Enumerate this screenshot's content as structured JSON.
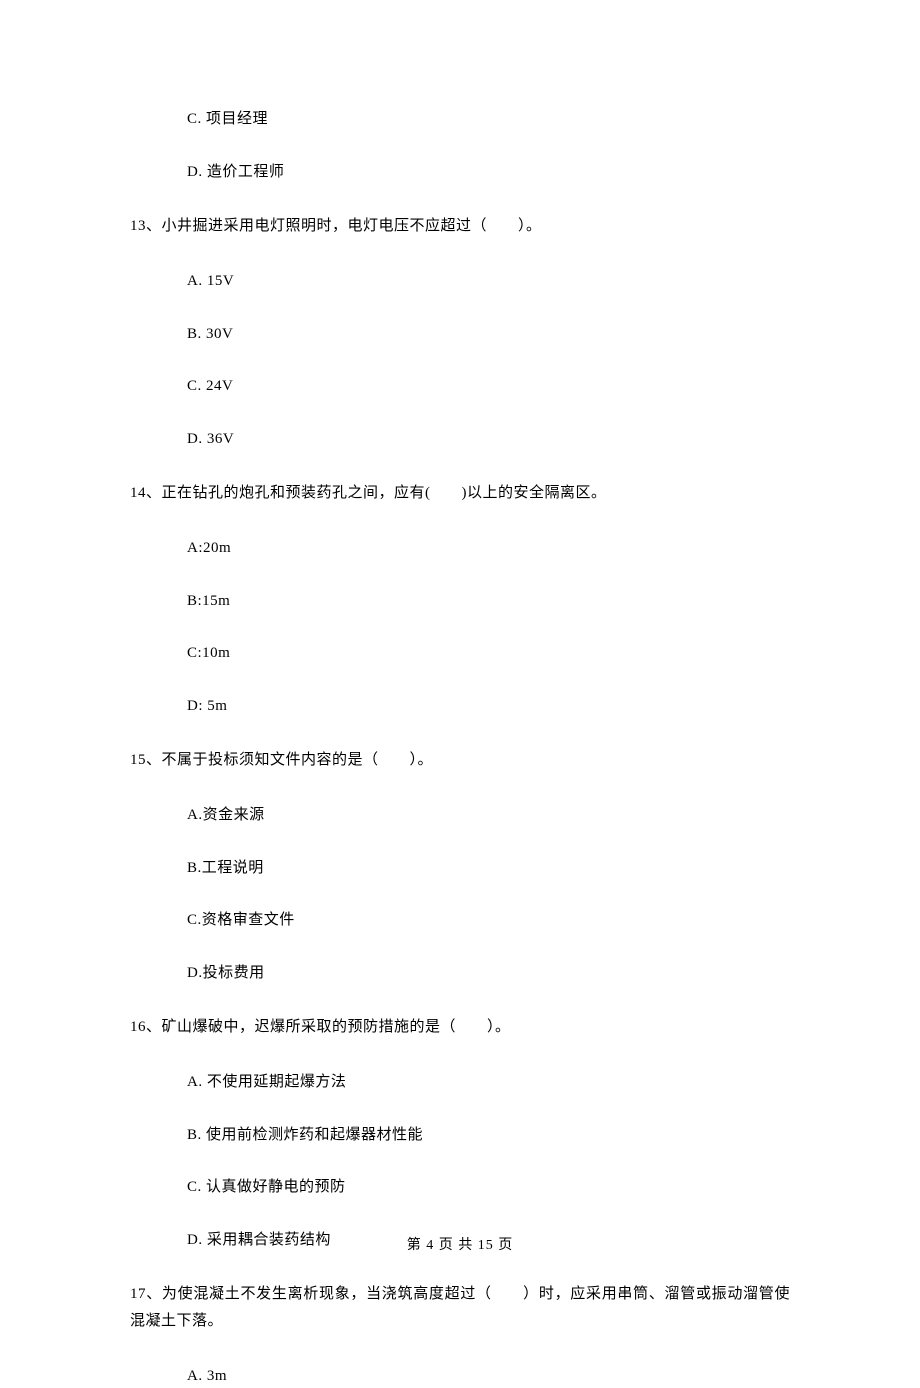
{
  "topOptions": {
    "c": "C. 项目经理",
    "d": "D. 造价工程师"
  },
  "q13": {
    "stem": "13、小井掘进采用电灯照明时，电灯电压不应超过（　　）。",
    "a": "A. 15V",
    "b": "B. 30V",
    "c": "C. 24V",
    "d": "D. 36V"
  },
  "q14": {
    "stem": "14、正在钻孔的炮孔和预装药孔之间，应有(　　)以上的安全隔离区。",
    "a": "A:20m",
    "b": "B:15m",
    "c": "C:10m",
    "d": "D: 5m"
  },
  "q15": {
    "stem": "15、不属于投标须知文件内容的是（　　）。",
    "a": "A.资金来源",
    "b": "B.工程说明",
    "c": "C.资格审查文件",
    "d": "D.投标费用"
  },
  "q16": {
    "stem": "16、矿山爆破中，迟爆所采取的预防措施的是（　　）。",
    "a": "A. 不使用延期起爆方法",
    "b": "B. 使用前检测炸药和起爆器材性能",
    "c": "C. 认真做好静电的预防",
    "d": "D. 采用耦合装药结构"
  },
  "q17": {
    "stem": "17、为使混凝土不发生离析现象，当浇筑高度超过（　　）时，应采用串筒、溜管或振动溜管使混凝土下落。",
    "a": "A. 3m"
  },
  "footer": "第 4 页 共 15 页"
}
